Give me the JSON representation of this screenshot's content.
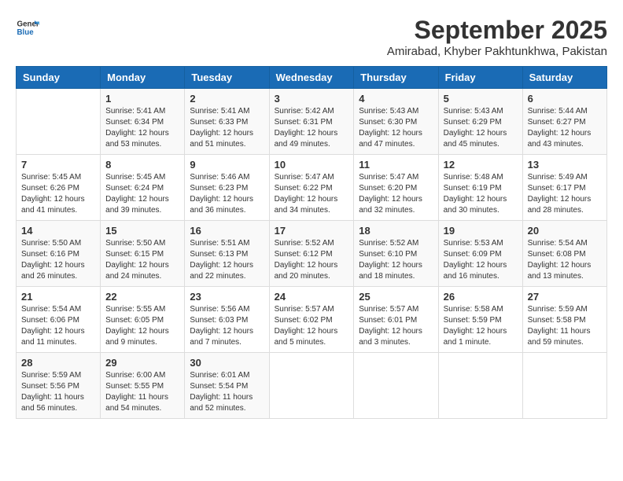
{
  "logo": {
    "text_general": "General",
    "text_blue": "Blue"
  },
  "title": "September 2025",
  "location": "Amirabad, Khyber Pakhtunkhwa, Pakistan",
  "days_of_week": [
    "Sunday",
    "Monday",
    "Tuesday",
    "Wednesday",
    "Thursday",
    "Friday",
    "Saturday"
  ],
  "weeks": [
    [
      {
        "day": "",
        "sunrise": "",
        "sunset": "",
        "daylight": ""
      },
      {
        "day": "1",
        "sunrise": "Sunrise: 5:41 AM",
        "sunset": "Sunset: 6:34 PM",
        "daylight": "Daylight: 12 hours and 53 minutes."
      },
      {
        "day": "2",
        "sunrise": "Sunrise: 5:41 AM",
        "sunset": "Sunset: 6:33 PM",
        "daylight": "Daylight: 12 hours and 51 minutes."
      },
      {
        "day": "3",
        "sunrise": "Sunrise: 5:42 AM",
        "sunset": "Sunset: 6:31 PM",
        "daylight": "Daylight: 12 hours and 49 minutes."
      },
      {
        "day": "4",
        "sunrise": "Sunrise: 5:43 AM",
        "sunset": "Sunset: 6:30 PM",
        "daylight": "Daylight: 12 hours and 47 minutes."
      },
      {
        "day": "5",
        "sunrise": "Sunrise: 5:43 AM",
        "sunset": "Sunset: 6:29 PM",
        "daylight": "Daylight: 12 hours and 45 minutes."
      },
      {
        "day": "6",
        "sunrise": "Sunrise: 5:44 AM",
        "sunset": "Sunset: 6:27 PM",
        "daylight": "Daylight: 12 hours and 43 minutes."
      }
    ],
    [
      {
        "day": "7",
        "sunrise": "Sunrise: 5:45 AM",
        "sunset": "Sunset: 6:26 PM",
        "daylight": "Daylight: 12 hours and 41 minutes."
      },
      {
        "day": "8",
        "sunrise": "Sunrise: 5:45 AM",
        "sunset": "Sunset: 6:24 PM",
        "daylight": "Daylight: 12 hours and 39 minutes."
      },
      {
        "day": "9",
        "sunrise": "Sunrise: 5:46 AM",
        "sunset": "Sunset: 6:23 PM",
        "daylight": "Daylight: 12 hours and 36 minutes."
      },
      {
        "day": "10",
        "sunrise": "Sunrise: 5:47 AM",
        "sunset": "Sunset: 6:22 PM",
        "daylight": "Daylight: 12 hours and 34 minutes."
      },
      {
        "day": "11",
        "sunrise": "Sunrise: 5:47 AM",
        "sunset": "Sunset: 6:20 PM",
        "daylight": "Daylight: 12 hours and 32 minutes."
      },
      {
        "day": "12",
        "sunrise": "Sunrise: 5:48 AM",
        "sunset": "Sunset: 6:19 PM",
        "daylight": "Daylight: 12 hours and 30 minutes."
      },
      {
        "day": "13",
        "sunrise": "Sunrise: 5:49 AM",
        "sunset": "Sunset: 6:17 PM",
        "daylight": "Daylight: 12 hours and 28 minutes."
      }
    ],
    [
      {
        "day": "14",
        "sunrise": "Sunrise: 5:50 AM",
        "sunset": "Sunset: 6:16 PM",
        "daylight": "Daylight: 12 hours and 26 minutes."
      },
      {
        "day": "15",
        "sunrise": "Sunrise: 5:50 AM",
        "sunset": "Sunset: 6:15 PM",
        "daylight": "Daylight: 12 hours and 24 minutes."
      },
      {
        "day": "16",
        "sunrise": "Sunrise: 5:51 AM",
        "sunset": "Sunset: 6:13 PM",
        "daylight": "Daylight: 12 hours and 22 minutes."
      },
      {
        "day": "17",
        "sunrise": "Sunrise: 5:52 AM",
        "sunset": "Sunset: 6:12 PM",
        "daylight": "Daylight: 12 hours and 20 minutes."
      },
      {
        "day": "18",
        "sunrise": "Sunrise: 5:52 AM",
        "sunset": "Sunset: 6:10 PM",
        "daylight": "Daylight: 12 hours and 18 minutes."
      },
      {
        "day": "19",
        "sunrise": "Sunrise: 5:53 AM",
        "sunset": "Sunset: 6:09 PM",
        "daylight": "Daylight: 12 hours and 16 minutes."
      },
      {
        "day": "20",
        "sunrise": "Sunrise: 5:54 AM",
        "sunset": "Sunset: 6:08 PM",
        "daylight": "Daylight: 12 hours and 13 minutes."
      }
    ],
    [
      {
        "day": "21",
        "sunrise": "Sunrise: 5:54 AM",
        "sunset": "Sunset: 6:06 PM",
        "daylight": "Daylight: 12 hours and 11 minutes."
      },
      {
        "day": "22",
        "sunrise": "Sunrise: 5:55 AM",
        "sunset": "Sunset: 6:05 PM",
        "daylight": "Daylight: 12 hours and 9 minutes."
      },
      {
        "day": "23",
        "sunrise": "Sunrise: 5:56 AM",
        "sunset": "Sunset: 6:03 PM",
        "daylight": "Daylight: 12 hours and 7 minutes."
      },
      {
        "day": "24",
        "sunrise": "Sunrise: 5:57 AM",
        "sunset": "Sunset: 6:02 PM",
        "daylight": "Daylight: 12 hours and 5 minutes."
      },
      {
        "day": "25",
        "sunrise": "Sunrise: 5:57 AM",
        "sunset": "Sunset: 6:01 PM",
        "daylight": "Daylight: 12 hours and 3 minutes."
      },
      {
        "day": "26",
        "sunrise": "Sunrise: 5:58 AM",
        "sunset": "Sunset: 5:59 PM",
        "daylight": "Daylight: 12 hours and 1 minute."
      },
      {
        "day": "27",
        "sunrise": "Sunrise: 5:59 AM",
        "sunset": "Sunset: 5:58 PM",
        "daylight": "Daylight: 11 hours and 59 minutes."
      }
    ],
    [
      {
        "day": "28",
        "sunrise": "Sunrise: 5:59 AM",
        "sunset": "Sunset: 5:56 PM",
        "daylight": "Daylight: 11 hours and 56 minutes."
      },
      {
        "day": "29",
        "sunrise": "Sunrise: 6:00 AM",
        "sunset": "Sunset: 5:55 PM",
        "daylight": "Daylight: 11 hours and 54 minutes."
      },
      {
        "day": "30",
        "sunrise": "Sunrise: 6:01 AM",
        "sunset": "Sunset: 5:54 PM",
        "daylight": "Daylight: 11 hours and 52 minutes."
      },
      {
        "day": "",
        "sunrise": "",
        "sunset": "",
        "daylight": ""
      },
      {
        "day": "",
        "sunrise": "",
        "sunset": "",
        "daylight": ""
      },
      {
        "day": "",
        "sunrise": "",
        "sunset": "",
        "daylight": ""
      },
      {
        "day": "",
        "sunrise": "",
        "sunset": "",
        "daylight": ""
      }
    ]
  ]
}
